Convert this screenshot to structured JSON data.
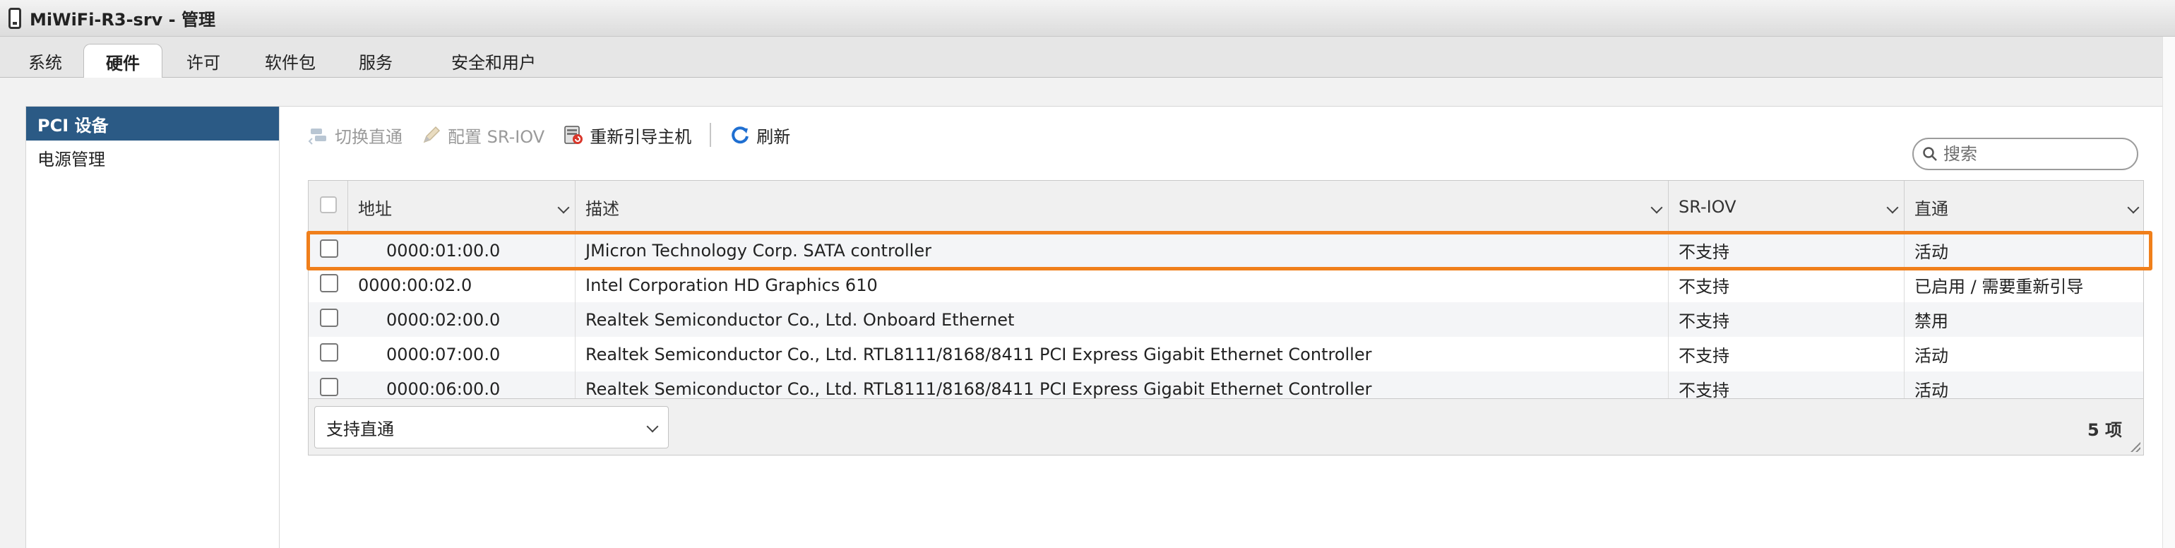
{
  "window": {
    "title": "MiWiFi-R3-srv - 管理"
  },
  "tabs": [
    {
      "label": "系统"
    },
    {
      "label": "硬件"
    },
    {
      "label": "许可"
    },
    {
      "label": "软件包"
    },
    {
      "label": "服务"
    },
    {
      "label": "安全和用户"
    }
  ],
  "active_tab": "硬件",
  "sidebar": {
    "items": [
      {
        "label": "PCI 设备"
      },
      {
        "label": "电源管理"
      }
    ],
    "active": "PCI 设备"
  },
  "toolbar": {
    "toggle_passthrough": "切换直通",
    "configure_sriov": "配置 SR-IOV",
    "reboot_host": "重新引导主机",
    "refresh": "刷新"
  },
  "search": {
    "placeholder": "搜索"
  },
  "table": {
    "columns": [
      "地址",
      "描述",
      "SR-IOV",
      "直通"
    ],
    "rows": [
      {
        "address": "0000:01:00.0",
        "description": "JMicron Technology Corp. SATA controller",
        "sriov": "不支持",
        "passthrough": "活动",
        "highlighted": true
      },
      {
        "address": "0000:00:02.0",
        "description": "Intel Corporation HD Graphics 610",
        "sriov": "不支持",
        "passthrough": "已启用 / 需要重新引导",
        "highlighted": false
      },
      {
        "address": "0000:02:00.0",
        "description": "Realtek Semiconductor Co., Ltd. Onboard Ethernet",
        "sriov": "不支持",
        "passthrough": "禁用",
        "highlighted": false
      },
      {
        "address": "0000:07:00.0",
        "description": "Realtek Semiconductor Co., Ltd. RTL8111/8168/8411 PCI Express Gigabit Ethernet Controller",
        "sriov": "不支持",
        "passthrough": "活动",
        "highlighted": false
      },
      {
        "address": "0000:06:00.0",
        "description": "Realtek Semiconductor Co., Ltd. RTL8111/8168/8411 PCI Express Gigabit Ethernet Controller",
        "sriov": "不支持",
        "passthrough": "活动",
        "highlighted": false
      }
    ]
  },
  "footer": {
    "filter_selected": "支持直通",
    "item_count": "5 项"
  },
  "colors": {
    "sidebar_active_bg": "#2b5a85",
    "highlight_border": "#f07f1b",
    "refresh_icon": "#1f6fd1"
  },
  "icons": {
    "host": "host-icon",
    "toggle_passthrough": "passthrough-icon",
    "configure_sriov": "pencil-icon",
    "reboot_host": "reboot-icon",
    "refresh": "refresh-icon",
    "search": "search-icon"
  }
}
